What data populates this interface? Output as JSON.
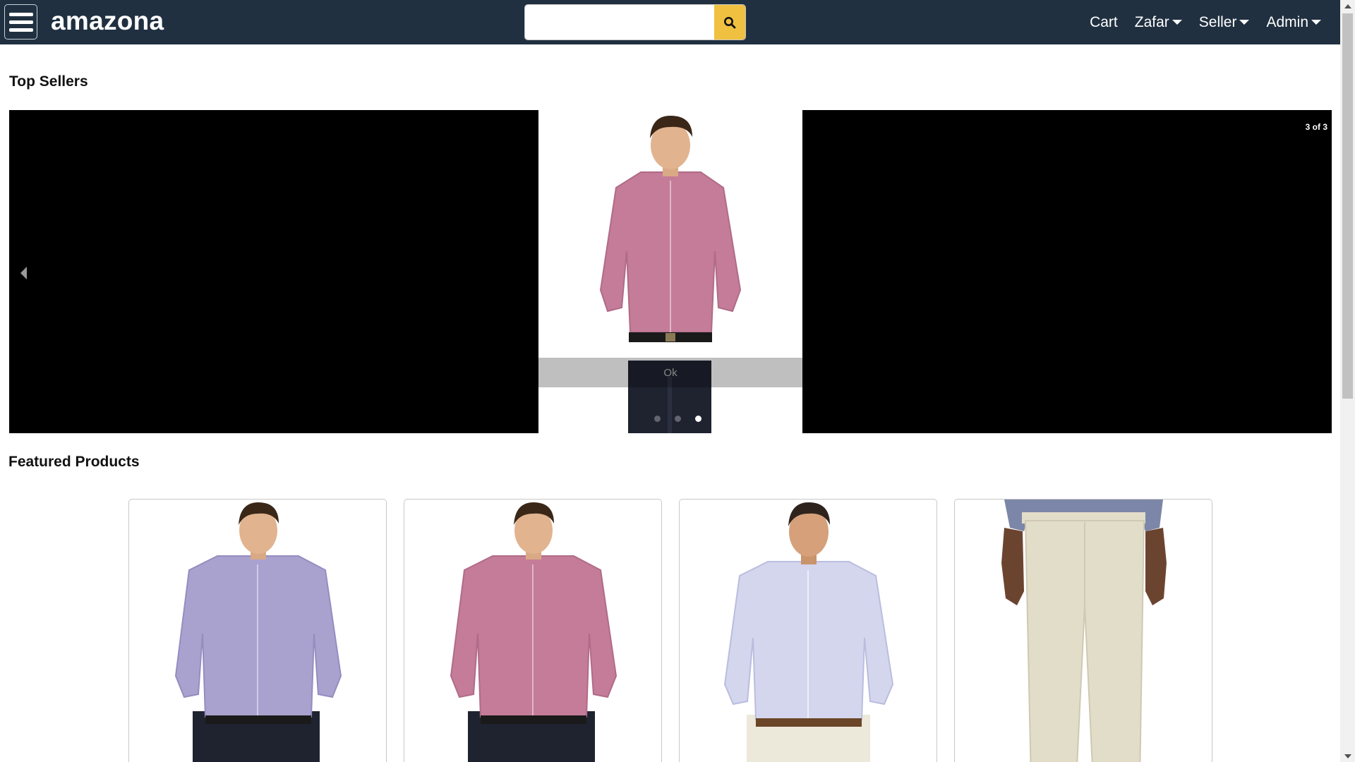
{
  "header": {
    "brand": "amazona",
    "search": {
      "value": "",
      "placeholder": ""
    },
    "nav": {
      "cart": "Cart",
      "user": "Zafar",
      "seller": "Seller",
      "admin": "Admin"
    }
  },
  "top_sellers": {
    "title": "Top Sellers",
    "counter": "3 of 3",
    "slide_legend": "Ok",
    "dots_count": 3,
    "active_dot": 3
  },
  "featured": {
    "title": "Featured Products",
    "products": [
      {
        "shirt_color": "#a9a2cf",
        "pants_color": "#1f2330",
        "kind": "shirt"
      },
      {
        "shirt_color": "#c47c98",
        "pants_color": "#1f2330",
        "kind": "shirt"
      },
      {
        "shirt_color": "#d4d6ee",
        "pants_color": "#ece8da",
        "kind": "shirt"
      },
      {
        "shirt_color": "#7c86a8",
        "pants_color": "#e2ddc9",
        "kind": "pants"
      }
    ]
  },
  "colors": {
    "header_bg": "#203040",
    "search_button": "#f0c040"
  }
}
